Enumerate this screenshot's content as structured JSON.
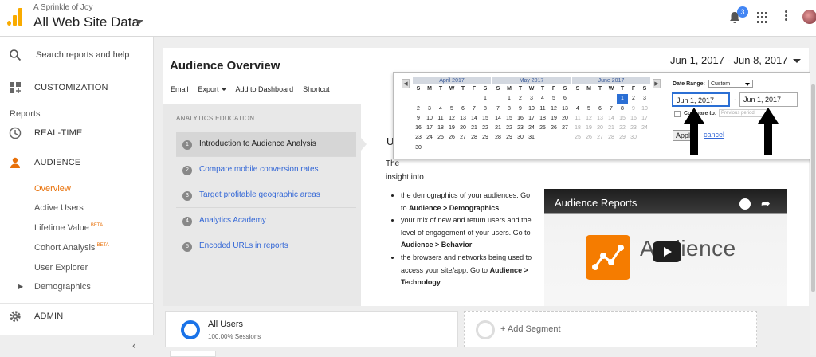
{
  "header": {
    "account_small": "A Sprinkle of Joy",
    "account_big": "All Web Site Data",
    "notification_count": "3",
    "colors": {
      "logo": "#f9ab00",
      "badge": "#4285f4"
    }
  },
  "sidebar": {
    "search_placeholder": "Search reports and help",
    "customization": "CUSTOMIZATION",
    "reports_label": "Reports",
    "realtime": "REAL-TIME",
    "audience": "AUDIENCE",
    "audience_items": [
      {
        "label": "Overview",
        "beta": ""
      },
      {
        "label": "Active Users",
        "beta": ""
      },
      {
        "label": "Lifetime Value",
        "beta": "BETA"
      },
      {
        "label": "Cohort Analysis",
        "beta": "BETA"
      },
      {
        "label": "User Explorer",
        "beta": ""
      },
      {
        "label": "Demographics",
        "beta": ""
      }
    ],
    "admin": "ADMIN",
    "active_color": "#e8710a"
  },
  "report": {
    "title": "Audience Overview",
    "tools": [
      "Email",
      "Export",
      "Add to Dashboard",
      "Shortcut"
    ],
    "date_range": "Jun 1, 2017 - Jun 8, 2017"
  },
  "education": {
    "header": "ANALYTICS EDUCATION",
    "items": [
      {
        "num": "1",
        "label": "Introduction to Audience Analysis"
      },
      {
        "num": "2",
        "label": "Compare mobile conversion rates"
      },
      {
        "num": "3",
        "label": "Target profitable geographic areas"
      },
      {
        "num": "4",
        "label": "Analytics Academy"
      },
      {
        "num": "5",
        "label": "Encoded URLs in reports"
      }
    ]
  },
  "content": {
    "heading": "Us",
    "intro_1": "The",
    "intro_2": "insight into",
    "bullets": [
      {
        "pre": "the demographics of your audiences. Go to ",
        "bold": "Audience > Demographics",
        "post": "."
      },
      {
        "pre": "your mix of new and return users and the level of engagement of your users. Go to ",
        "bold": "Audience > Behavior",
        "post": "."
      },
      {
        "pre": "the browsers and networks being used to access your site/app. Go to ",
        "bold": "Audience > Technology",
        "post": ""
      }
    ],
    "video_title": "Audience Reports",
    "video_word": "Audience"
  },
  "segments": {
    "seg1_name": "All Users",
    "seg1_sub": "100.00% Sessions",
    "add_segment": "+ Add Segment"
  },
  "calendar": {
    "weekdays": [
      "S",
      "M",
      "T",
      "W",
      "T",
      "F",
      "S"
    ],
    "months": [
      {
        "title": "April 2017",
        "start": 6,
        "days": 30
      },
      {
        "title": "May 2017",
        "start": 1,
        "days": 31
      },
      {
        "title": "June 2017",
        "start": 4,
        "days": 30,
        "selected": 1,
        "last_active": 8
      }
    ],
    "date_range_label": "Date Range:",
    "date_range_value": "Custom",
    "start_date": "Jun 1, 2017",
    "end_date": "Jun 1, 2017",
    "dash": "-",
    "compare_label": "Compare to:",
    "compare_placeholder": "Previous period",
    "apply": "Apply",
    "cancel": "cancel",
    "nav_prev": "◀",
    "nav_next": "▶"
  }
}
